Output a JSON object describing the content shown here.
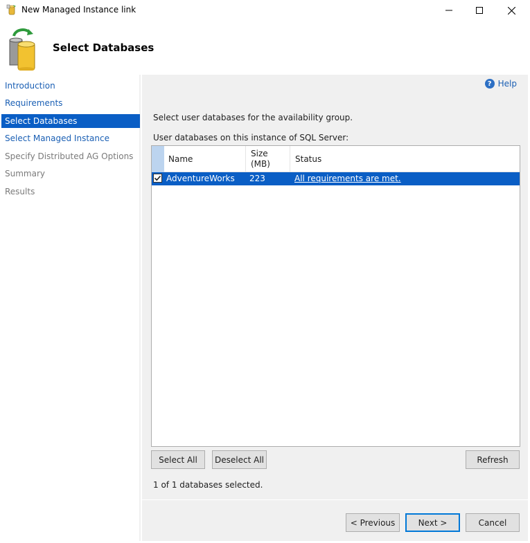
{
  "window": {
    "title": "New Managed Instance link",
    "app_icon": "managed-instance-app-icon",
    "controls": {
      "minimize_icon": "minimize-icon",
      "maximize_icon": "maximize-icon",
      "close_icon": "close-icon"
    }
  },
  "header": {
    "title": "Select Databases",
    "icon": "database-sync-icon"
  },
  "nav": {
    "items": [
      {
        "label": "Introduction",
        "state": "link"
      },
      {
        "label": "Requirements",
        "state": "link"
      },
      {
        "label": "Select Databases",
        "state": "active"
      },
      {
        "label": "Select Managed Instance",
        "state": "link"
      },
      {
        "label": "Specify Distributed AG Options",
        "state": "disabled"
      },
      {
        "label": "Summary",
        "state": "disabled"
      },
      {
        "label": "Results",
        "state": "disabled"
      }
    ]
  },
  "main": {
    "help_label": "Help",
    "help_icon": "help-icon",
    "instruction": "Select user databases for the availability group.",
    "grid_label": "User databases on this instance of SQL Server:",
    "columns": {
      "name": "Name",
      "size_line1": "Size",
      "size_line2": "(MB)",
      "status": "Status"
    },
    "rows": [
      {
        "checked": true,
        "name": "AdventureWorks",
        "size": "223",
        "status": "All requirements are met."
      }
    ],
    "buttons": {
      "select_all": "Select All",
      "deselect_all": "Deselect All",
      "refresh": "Refresh"
    },
    "selection_summary": "1 of 1 databases selected."
  },
  "footer": {
    "previous": "< Previous",
    "next": "Next >",
    "cancel": "Cancel"
  },
  "colors": {
    "accent": "#0a5ec5",
    "link": "#1a5fb4",
    "panel": "#f0f0f0"
  }
}
